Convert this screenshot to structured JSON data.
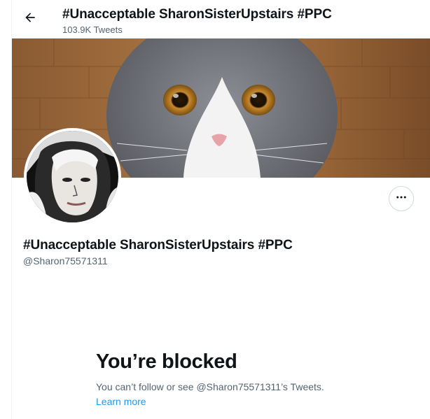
{
  "header": {
    "title": "#Unacceptable SharonSisterUpstairs #PPC",
    "tweet_count": "103.9K Tweets",
    "back_icon": "arrow-left-icon"
  },
  "profile": {
    "display_name": "#Unacceptable SharonSisterUpstairs #PPC",
    "handle": "@Sharon75571311",
    "banner": "grey-and-white-cat-photo",
    "avatar": "high-contrast-portrait-photo",
    "more_icon": "more-horizontal-icon"
  },
  "blocked_notice": {
    "title": "You’re blocked",
    "message": "You can’t follow or see @Sharon75571311’s Tweets.",
    "link_label": "Learn more"
  },
  "colors": {
    "text_primary": "#0f1419",
    "text_secondary": "#536471",
    "link": "#1d9bf0",
    "border": "#cfd9de"
  }
}
